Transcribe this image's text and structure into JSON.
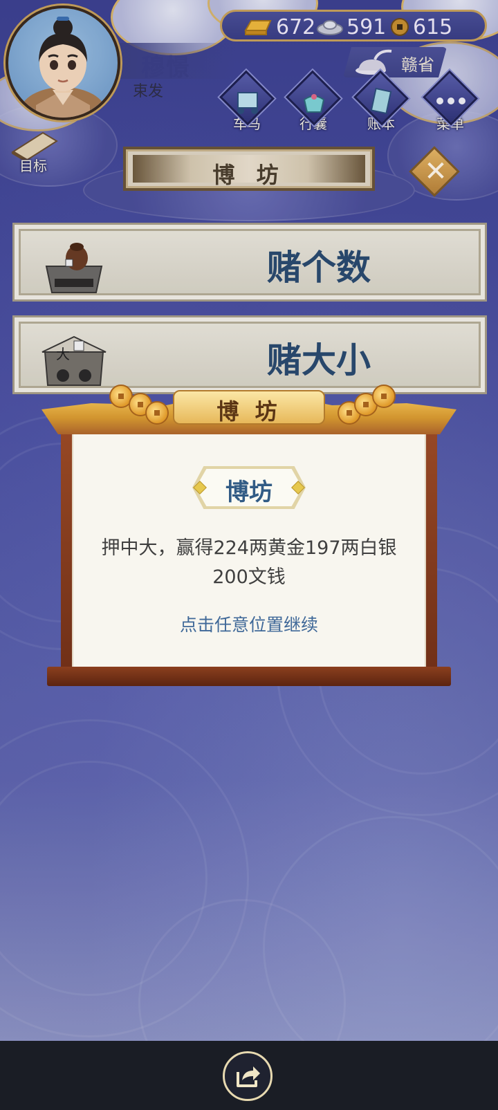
{
  "player": {
    "name": "穆憬",
    "title": "束发"
  },
  "currency": {
    "gold": "672",
    "silver": "591",
    "coin": "615"
  },
  "region": {
    "name": "赣省"
  },
  "menu": {
    "items": [
      {
        "label": "车马",
        "icon": "carriage-icon"
      },
      {
        "label": "行囊",
        "icon": "bag-icon"
      },
      {
        "label": "账本",
        "icon": "ledger-icon"
      },
      {
        "label": "菜单",
        "icon": "more-icon"
      }
    ],
    "goal_label": "目标"
  },
  "page": {
    "title": "博 坊"
  },
  "games": [
    {
      "label": "赌个数",
      "icon": "cup-dice-icon"
    },
    {
      "label": "赌大小",
      "icon": "dice-table-icon"
    }
  ],
  "dialog": {
    "header": "博 坊",
    "title": "博坊",
    "result_line1": "押中大，赢得224两黄金197两白银",
    "result_line2": "200文钱",
    "continue": "点击任意位置继续"
  },
  "colors": {
    "background": "#4a4fa0",
    "gold_trim": "#c9a25a",
    "dialog_frame": "#8b3f1e",
    "title_blue": "#2a4a6e",
    "continue_blue": "#3f6898"
  }
}
